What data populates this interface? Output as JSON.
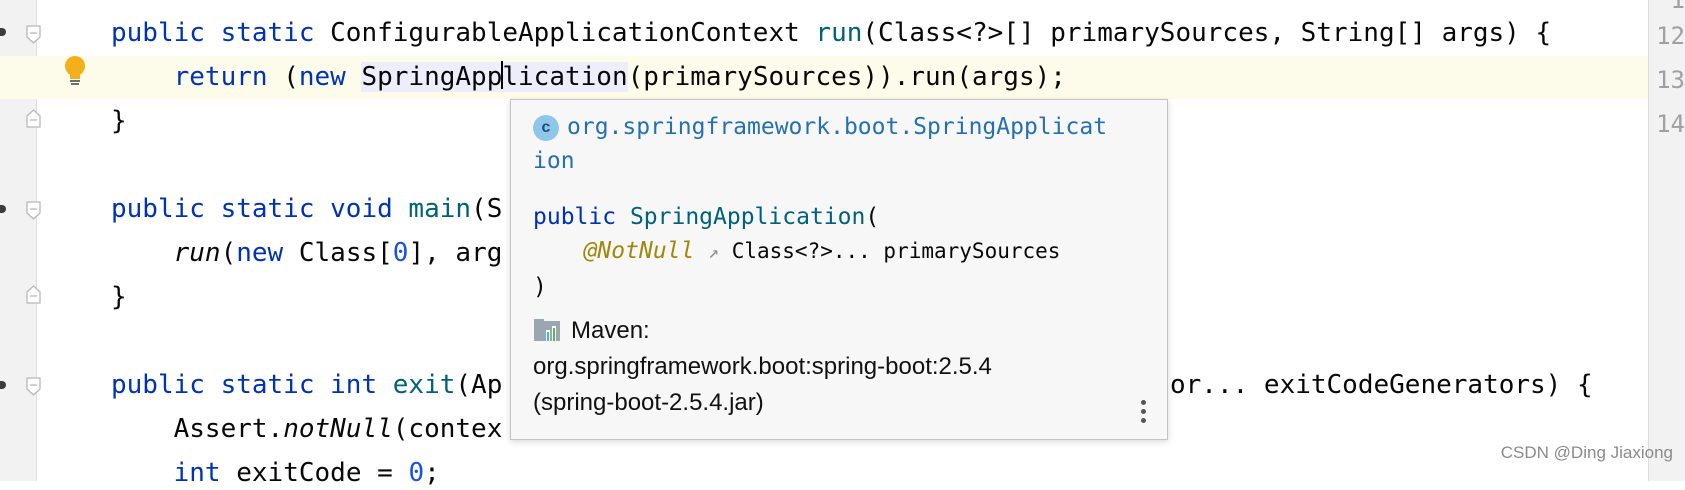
{
  "editor": {
    "lines": [
      {
        "tokens": [
          {
            "t": "public static ",
            "c": "kw"
          },
          {
            "t": "ConfigurableApplicationContext "
          },
          {
            "t": "run",
            "c": "fn"
          },
          {
            "t": "(Class<?>[] primarySources, String[] args) {"
          }
        ]
      },
      {
        "tokens": [
          {
            "t": "    "
          },
          {
            "t": "return ",
            "c": "kw"
          },
          {
            "t": "("
          },
          {
            "t": "new ",
            "c": "kw"
          }
        ]
      },
      {
        "tokens": [
          {
            "t": "}"
          }
        ]
      },
      {
        "tokens": []
      },
      {
        "tokens": [
          {
            "t": "public static void ",
            "c": "kw"
          },
          {
            "t": "main",
            "c": "fn"
          },
          {
            "t": "(S"
          }
        ]
      },
      {
        "tokens": [
          {
            "t": "    "
          },
          {
            "t": "run",
            "c": "it"
          },
          {
            "t": "("
          },
          {
            "t": "new ",
            "c": "kw"
          },
          {
            "t": "Class["
          },
          {
            "t": "0",
            "c": "num"
          },
          {
            "t": "], arg"
          }
        ]
      },
      {
        "tokens": [
          {
            "t": "}"
          }
        ]
      },
      {
        "tokens": []
      },
      {
        "tokens": [
          {
            "t": "public static int ",
            "c": "kw"
          },
          {
            "t": "exit",
            "c": "fn"
          },
          {
            "t": "(Ap"
          }
        ]
      },
      {
        "tokens": [
          {
            "t": "    "
          },
          {
            "t": "Assert."
          },
          {
            "t": "notNull",
            "c": "it"
          },
          {
            "t": "(contex"
          }
        ]
      },
      {
        "tokens": [
          {
            "t": "    "
          },
          {
            "t": "int ",
            "c": "kw"
          },
          {
            "t": "exitCode = "
          },
          {
            "t": "0",
            "c": "num"
          },
          {
            "t": ";"
          }
        ]
      }
    ],
    "line2_word_before": "SpringApp",
    "line2_word_after": "lication",
    "line2_rest": "(primarySources)).run(args);",
    "line8_tail": "or... exitCodeGenerators) {",
    "right_line_numbers": [
      "12",
      "13",
      "14"
    ]
  },
  "popup": {
    "class_badge": "c",
    "fqcn_line1": "org.springframework.boot.SpringApplicat",
    "fqcn_line2": "ion",
    "sig_kw": "public ",
    "sig_name": "SpringApplication",
    "sig_open": "(",
    "sig_annot": "@NotNull",
    "sig_arrow": "↗",
    "sig_param": " Class<?>... primarySources",
    "sig_close": ")",
    "maven_label": "Maven:",
    "maven_coord": "org.springframework.boot:spring-boot:2.5.4",
    "maven_jar": "(spring-boot-2.5.4.jar)"
  },
  "watermark": "CSDN @Ding Jiaxiong",
  "colors": {
    "keyword": "#0033b3",
    "function": "#00627a",
    "number": "#1750eb",
    "link": "#2470b3",
    "annotation": "#9e880d"
  }
}
